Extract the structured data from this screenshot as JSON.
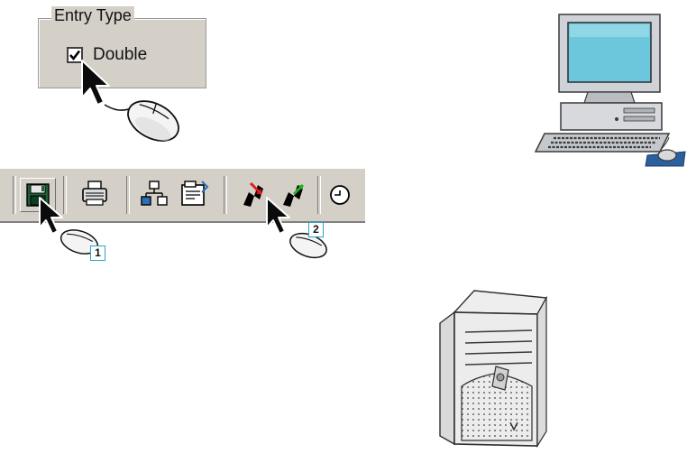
{
  "entry_type": {
    "group_title": "Entry Type",
    "checkbox_label": "Double",
    "checked": true
  },
  "toolbar": {
    "buttons": [
      {
        "icon": "save-disk-icon"
      },
      {
        "icon": "printer-icon"
      },
      {
        "icon": "network-tree-icon"
      },
      {
        "icon": "properties-icon"
      },
      {
        "icon": "disconnect-red-icon"
      },
      {
        "icon": "connect-green-icon"
      },
      {
        "icon": "clock-icon"
      }
    ]
  },
  "callouts": {
    "step1": "1",
    "step2": "2"
  },
  "colors": {
    "panel": "#d4d0c8",
    "callout_border": "#2aa4c8",
    "disk": "#1f5f3a",
    "red_arrow": "#e01b1b",
    "green_arrow": "#27b12b",
    "monitor_screen": "#6cc7dd"
  }
}
